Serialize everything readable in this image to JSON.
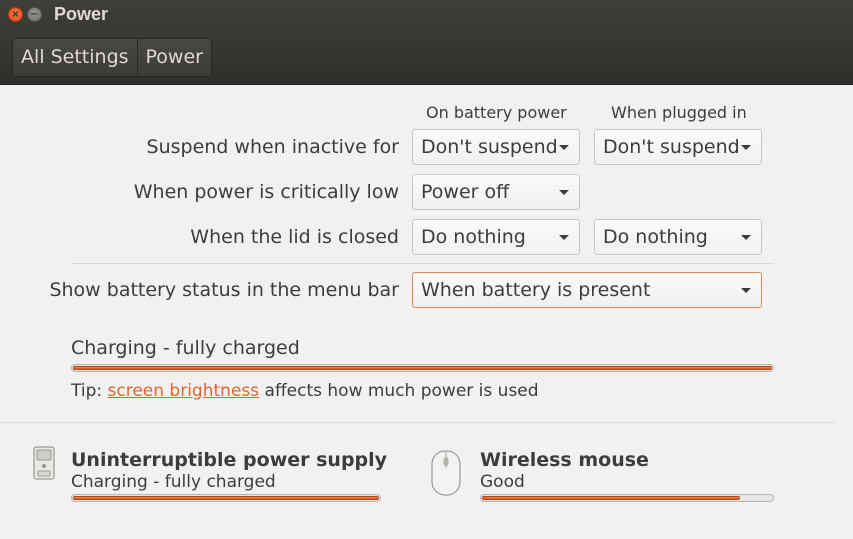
{
  "window": {
    "title": "Power",
    "close_glyph": "×",
    "minimize_glyph": "−"
  },
  "toolbar": {
    "crumbs": [
      "All Settings",
      "Power"
    ]
  },
  "columns": {
    "battery": "On battery power",
    "plugged": "When plugged in"
  },
  "rows": {
    "suspend": {
      "label": "Suspend when inactive for",
      "battery": "Don't suspend",
      "plugged": "Don't suspend"
    },
    "critical": {
      "label": "When power is critically low",
      "battery": "Power off"
    },
    "lid": {
      "label": "When the lid is closed",
      "battery": "Do nothing",
      "plugged": "Do nothing"
    },
    "menubar": {
      "label": "Show battery status in the menu bar",
      "value": "When battery is present"
    }
  },
  "battery": {
    "status": "Charging - fully charged",
    "level": 1.0
  },
  "tip": {
    "prefix": "Tip: ",
    "link": "screen brightness",
    "suffix": " affects how much power is used"
  },
  "devices": [
    {
      "icon": "ups-icon",
      "name": "Uninterruptible power supply",
      "status": "Charging - fully charged",
      "level": 1.0
    },
    {
      "icon": "mouse-icon",
      "name": "Wireless mouse",
      "status": "Good",
      "level": 0.89
    }
  ],
  "colors": {
    "accent": "#e0652f",
    "titlebar": "#3c3b37",
    "background": "#f2f1f0"
  }
}
